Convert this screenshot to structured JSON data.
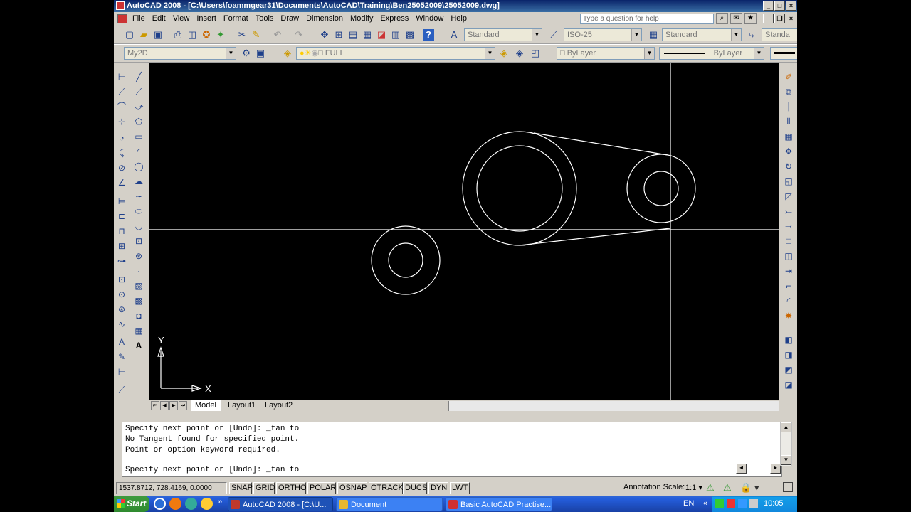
{
  "title": "AutoCAD 2008 - [C:\\Users\\foammgear31\\Documents\\AutoCAD\\Training\\Ben25052009\\25052009.dwg]",
  "menu": [
    "File",
    "Edit",
    "View",
    "Insert",
    "Format",
    "Tools",
    "Draw",
    "Dimension",
    "Modify",
    "Express",
    "Window",
    "Help"
  ],
  "help_placeholder": "Type a question for help",
  "styles": {
    "text_style": "Standard",
    "dim_style": "ISO-25",
    "table_style": "Standard",
    "multileader_style": "Standa"
  },
  "workspace": "My2D",
  "layer": "FULL",
  "color": "ByLayer",
  "linetype": "ByLayer",
  "ucs": {
    "y_label": "Y",
    "x_label": "X"
  },
  "tabs": [
    "Model",
    "Layout1",
    "Layout2"
  ],
  "command_history": [
    "Specify next point or [Undo]: _tan to",
    "No Tangent found for specified point.",
    "Point or option keyword required."
  ],
  "command_line": "Specify next point or [Undo]: _tan to",
  "coordinates": "1537.8712, 728.4169, 0.0000",
  "status_toggles": [
    "SNAP",
    "GRID",
    "ORTHO",
    "POLAR",
    "OSNAP",
    "OTRACK",
    "DUCS",
    "DYN",
    "LWT"
  ],
  "annotation_scale_label": "Annotation Scale:",
  "annotation_scale": "1:1",
  "taskbar": {
    "start": "Start",
    "tasks": [
      {
        "label": "AutoCAD 2008 - [C:\\U...",
        "active": true,
        "color": "#c0392b"
      },
      {
        "label": "Document",
        "active": false,
        "color": "#e8b830"
      },
      {
        "label": "Basic AutoCAD Practise....",
        "active": false,
        "color": "#d03030"
      }
    ],
    "language": "EN",
    "clock": "10:05"
  }
}
